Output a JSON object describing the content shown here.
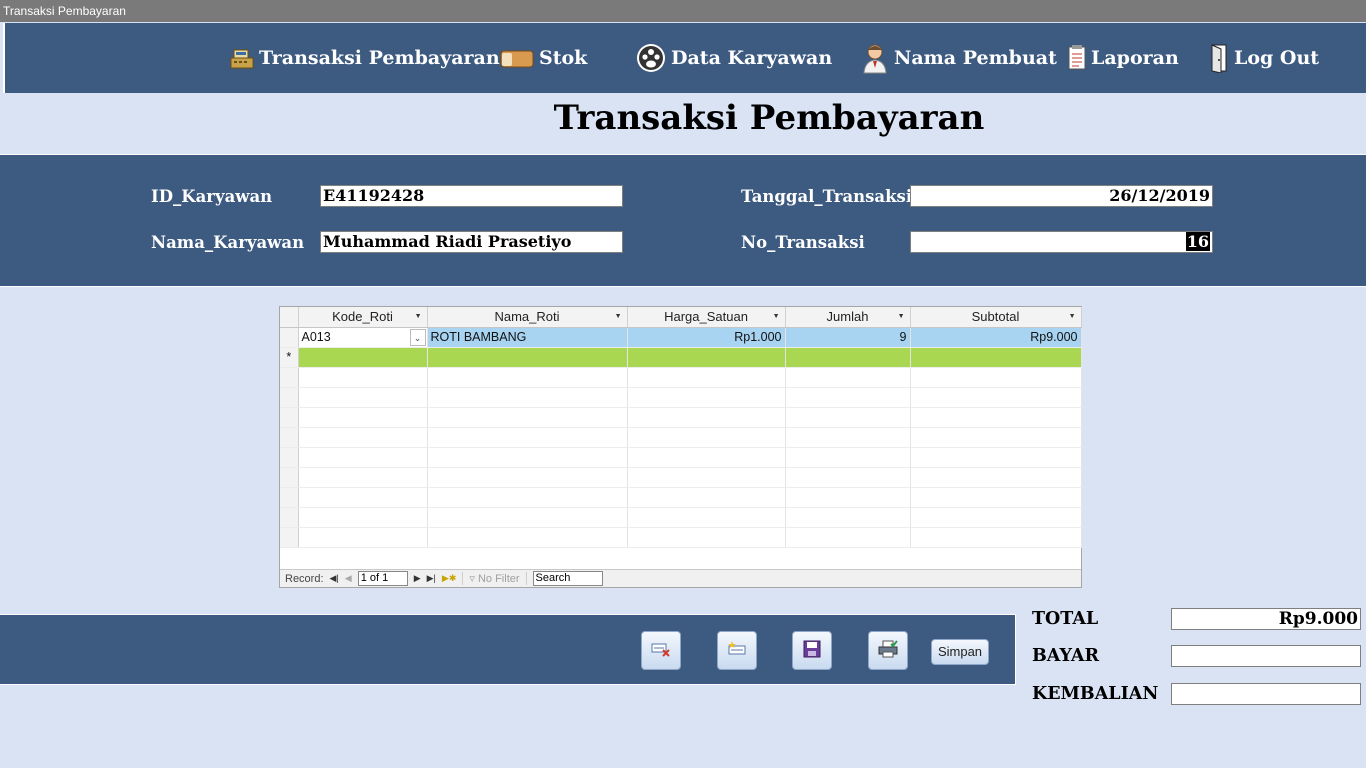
{
  "window": {
    "title": "Transaksi Pembayaran"
  },
  "nav": {
    "items": [
      {
        "label": "Transaksi Pembayaran",
        "icon": "cash-register-icon"
      },
      {
        "label": "Stok",
        "icon": "bread-icon"
      },
      {
        "label": "Data Karyawan",
        "icon": "people-icon"
      },
      {
        "label": "Nama Pembuat",
        "icon": "person-avatar-icon"
      },
      {
        "label": "Laporan",
        "icon": "report-icon"
      },
      {
        "label": "Log Out",
        "icon": "exit-door-icon"
      }
    ]
  },
  "page": {
    "title": "Transaksi Pembayaran"
  },
  "form": {
    "id_karyawan_label": "ID_Karyawan",
    "id_karyawan_value": "E41192428",
    "nama_karyawan_label": "Nama_Karyawan",
    "nama_karyawan_value": "Muhammad Riadi Prasetiyo",
    "tanggal_label": "Tanggal_Transaksi",
    "tanggal_value": "26/12/2019",
    "no_transaksi_label": "No_Transaksi",
    "no_transaksi_value": "16"
  },
  "grid": {
    "columns": [
      "Kode_Roti",
      "Nama_Roti",
      "Harga_Satuan",
      "Jumlah",
      "Subtotal"
    ],
    "rows": [
      {
        "kode": "A013",
        "nama": "ROTI BAMBANG",
        "harga": "Rp1.000",
        "jumlah": "9",
        "subtotal": "Rp9.000"
      }
    ],
    "new_row_marker": "*",
    "record_label": "Record:",
    "record_position": "1 of 1",
    "no_filter": "No Filter",
    "search": "Search"
  },
  "footer": {
    "buttons": [
      "delete-record-icon",
      "new-record-icon",
      "save-disk-icon",
      "print-icon"
    ],
    "simpan_label": "Simpan"
  },
  "totals": {
    "total_label": "TOTAL",
    "total_value": "Rp9.000",
    "bayar_label": "BAYAR",
    "bayar_value": "",
    "kembalian_label": "KEMBALIAN",
    "kembalian_value": ""
  },
  "colors": {
    "panel": "#3d5a80",
    "background": "#dae3f3",
    "active_row": "#a8d4f2",
    "new_row": "#a9d751"
  }
}
